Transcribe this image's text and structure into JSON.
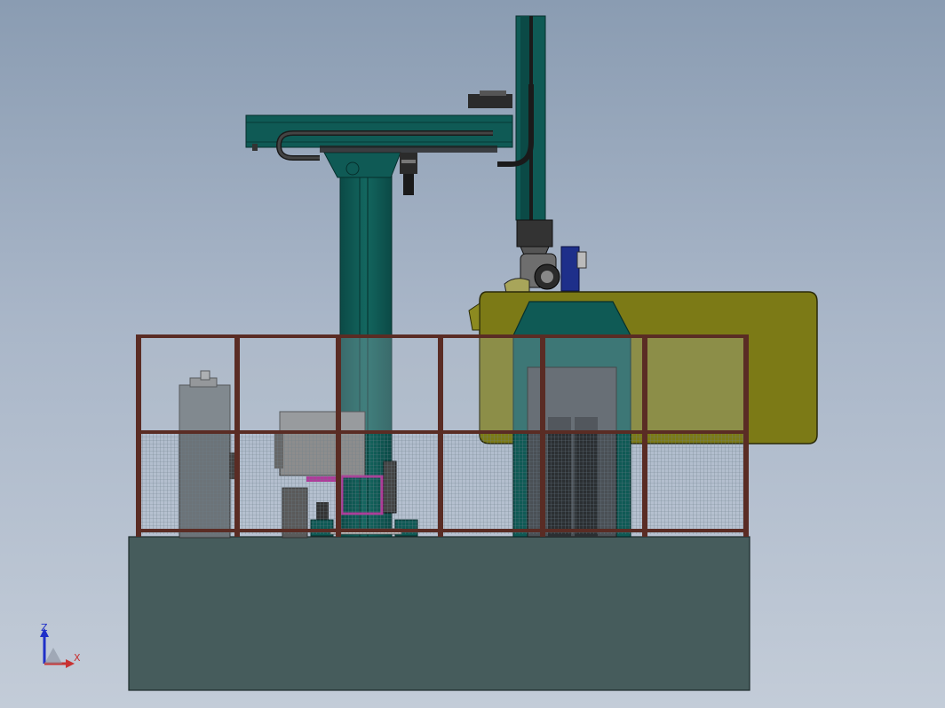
{
  "viewport": {
    "background_top": "#8a9cb2",
    "background_bottom": "#c3ccd8"
  },
  "model": {
    "colors": {
      "column": "#0f5a55",
      "column_dark": "#083f3c",
      "base": "#465c5c",
      "fence": "#5a2c24",
      "mesh": "#7d8f9a",
      "yellow_housing": "#7c7a16",
      "yellow_housing_dark": "#55530c",
      "cabinet": "#6c7378",
      "motor_gray": "#8d8d8d",
      "black": "#1a1a1a",
      "blue_unit": "#1e2f8a",
      "magenta_frame": "#b03a9a"
    }
  },
  "triad": {
    "z_label": "Z",
    "x_label": "X",
    "z_color": "#1f2fc8",
    "x_color": "#c83232"
  }
}
